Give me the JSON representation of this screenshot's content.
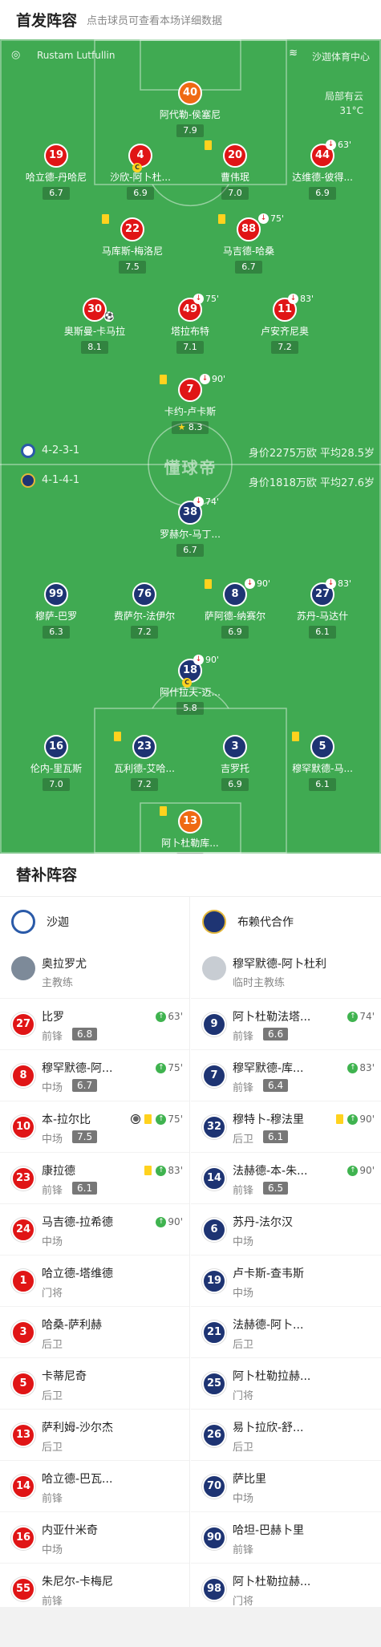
{
  "header": {
    "title": "首发阵容",
    "subtitle": "点击球员可查看本场详细数据"
  },
  "pitch": {
    "referee": "Rustam Lutfullin",
    "venue": "沙迦体育中心",
    "weather": "局部有云",
    "temperature": "31°C",
    "watermark": "懂球帝",
    "home": {
      "formation": "4-2-3-1",
      "value": "身价2275万欧 平均28.5岁",
      "color": "#e01516"
    },
    "away": {
      "formation": "4-1-4-1",
      "value": "身价1818万欧 平均27.6岁",
      "color": "#1e3473"
    }
  },
  "home_players": [
    {
      "num": "40",
      "name": "阿代勒-侯塞尼",
      "rating": "7.9",
      "gk": true
    },
    {
      "num": "19",
      "name": "哈立德-丹哈尼",
      "rating": "6.7"
    },
    {
      "num": "4",
      "name": "沙欣-阿卜杜...",
      "rating": "6.9",
      "captain": "C"
    },
    {
      "num": "20",
      "name": "曹伟珉",
      "rating": "7.0",
      "yellow": true
    },
    {
      "num": "44",
      "name": "达维德-彼得...",
      "rating": "6.9",
      "subout": "63'"
    },
    {
      "num": "22",
      "name": "马库斯-梅洛尼",
      "rating": "7.5",
      "yellow": true
    },
    {
      "num": "88",
      "name": "马吉德-哈桑",
      "rating": "6.7",
      "yellow": true,
      "subout": "75'"
    },
    {
      "num": "30",
      "name": "奥斯曼-卡马拉",
      "rating": "8.1",
      "ball": true
    },
    {
      "num": "49",
      "name": "塔拉布特",
      "rating": "7.1",
      "subout": "75'"
    },
    {
      "num": "11",
      "name": "卢安齐尼奥",
      "rating": "7.2",
      "subout": "83'"
    },
    {
      "num": "7",
      "name": "卡约-卢卡斯",
      "rating": "8.3",
      "yellow": true,
      "subout": "90'",
      "best": true
    }
  ],
  "away_players": [
    {
      "num": "38",
      "name": "罗赫尔-马丁...",
      "rating": "6.7",
      "subout": "74'"
    },
    {
      "num": "99",
      "name": "穆萨-巴罗",
      "rating": "6.3"
    },
    {
      "num": "76",
      "name": "费萨尔-法伊尔",
      "rating": "7.2"
    },
    {
      "num": "8",
      "name": "萨阿德-纳赛尔",
      "rating": "6.9",
      "yellow": true,
      "subout": "90'"
    },
    {
      "num": "27",
      "name": "苏丹-马达什",
      "rating": "6.1",
      "subout": "83'"
    },
    {
      "num": "18",
      "name": "阿什拉夫-迈...",
      "rating": "5.8",
      "subout": "90'",
      "captain": "C"
    },
    {
      "num": "16",
      "name": "伦内-里瓦斯",
      "rating": "7.0"
    },
    {
      "num": "23",
      "name": "瓦利德-艾哈...",
      "rating": "7.2",
      "yellow": true
    },
    {
      "num": "3",
      "name": "吉罗托",
      "rating": "6.9"
    },
    {
      "num": "5",
      "name": "穆罕默德-马...",
      "rating": "6.1",
      "yellow": true
    },
    {
      "num": "13",
      "name": "阿卜杜勒库...",
      "rating": "7.0",
      "yellow": true,
      "gk": true
    }
  ],
  "subs_title": "替补阵容",
  "home_team": {
    "name": "沙迦",
    "coach": "奥拉罗尤",
    "coach_role": "主教练"
  },
  "away_team": {
    "name": "布赖代合作",
    "coach": "穆罕默德-阿卜杜利",
    "coach_role": "临时主教练"
  },
  "home_subs": [
    {
      "num": "27",
      "name": "比罗",
      "pos": "前锋",
      "rating": "6.8",
      "in": "63'"
    },
    {
      "num": "8",
      "name": "穆罕默德-阿...",
      "pos": "中场",
      "rating": "6.7",
      "in": "75'"
    },
    {
      "num": "10",
      "name": "本-拉尔比",
      "pos": "中场",
      "rating": "7.5",
      "in": "75'",
      "yellow": true,
      "ball": true
    },
    {
      "num": "23",
      "name": "康拉德",
      "pos": "前锋",
      "rating": "6.1",
      "in": "83'",
      "yellow": true
    },
    {
      "num": "24",
      "name": "马吉德-拉希德",
      "pos": "中场",
      "in": "90'"
    },
    {
      "num": "1",
      "name": "哈立德-塔维德",
      "pos": "门将"
    },
    {
      "num": "3",
      "name": "哈桑-萨利赫",
      "pos": "后卫"
    },
    {
      "num": "5",
      "name": "卡蒂尼奇",
      "pos": "后卫"
    },
    {
      "num": "13",
      "name": "萨利姆-沙尔杰",
      "pos": "后卫"
    },
    {
      "num": "14",
      "name": "哈立德-巴瓦...",
      "pos": "前锋"
    },
    {
      "num": "16",
      "name": "内亚什米奇",
      "pos": "中场"
    },
    {
      "num": "55",
      "name": "朱尼尔-卡梅尼",
      "pos": "前锋"
    }
  ],
  "away_subs": [
    {
      "num": "9",
      "name": "阿卜杜勒法塔...",
      "pos": "前锋",
      "rating": "6.6",
      "in": "74'"
    },
    {
      "num": "7",
      "name": "穆罕默德-库...",
      "pos": "前锋",
      "rating": "6.4",
      "in": "83'"
    },
    {
      "num": "32",
      "name": "穆特卜-穆法里",
      "pos": "后卫",
      "rating": "6.1",
      "in": "90'",
      "yellow": true
    },
    {
      "num": "14",
      "name": "法赫德-本-朱...",
      "pos": "前锋",
      "rating": "6.5",
      "in": "90'"
    },
    {
      "num": "6",
      "name": "苏丹-法尔汉",
      "pos": "中场"
    },
    {
      "num": "19",
      "name": "卢卡斯-查韦斯",
      "pos": "中场"
    },
    {
      "num": "21",
      "name": "法赫德-阿卜...",
      "pos": "后卫"
    },
    {
      "num": "25",
      "name": "阿卜杜勒拉赫...",
      "pos": "门将"
    },
    {
      "num": "26",
      "name": "易卜拉欣-舒...",
      "pos": "后卫"
    },
    {
      "num": "70",
      "name": "萨比里",
      "pos": "中场"
    },
    {
      "num": "90",
      "name": "哈坦-巴赫卜里",
      "pos": "前锋"
    },
    {
      "num": "98",
      "name": "阿卜杜勒拉赫...",
      "pos": "门将"
    }
  ]
}
